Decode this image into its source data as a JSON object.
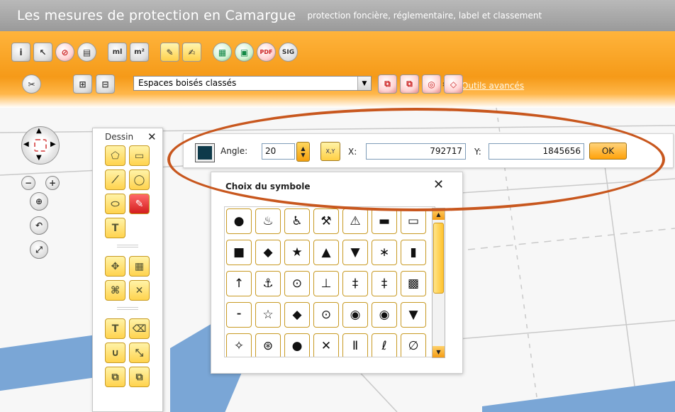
{
  "title": {
    "main": "Les mesures de protection en Camargue",
    "subtitle": "protection foncière, réglementaire, label et classement"
  },
  "toolbar": {
    "row1_icons": [
      "info-icon",
      "pointer-icon",
      "no-entry-icon",
      "export-icon",
      "measure-length-icon",
      "measure-area-icon",
      "draw-pencil-icon",
      "annotate-icon",
      "export-excel-icon",
      "export-map-icon",
      "export-pdf-icon",
      "sig-icon"
    ],
    "ml_label": "ml",
    "m2_label": "m²",
    "sig_label": "SIG",
    "info_label": "i",
    "advanced_tools_label": "Outils avancés",
    "layer_select_value": "Espaces boisés classés",
    "row2_icons": [
      "cut-icon",
      "add-layer-icon",
      "remove-layer-icon"
    ],
    "row2_right_icons": [
      "edit-red-1-icon",
      "edit-red-2-icon",
      "edit-red-3-icon",
      "edit-red-4-icon"
    ]
  },
  "navigation": {
    "zoom_minus": "−",
    "zoom_plus": "+",
    "buttons": [
      "zoom-box-icon",
      "back-icon",
      "full-extent-icon"
    ]
  },
  "dessin_panel": {
    "title": "Dessin",
    "close": "✕",
    "text_tool_label": "T"
  },
  "angle_bar": {
    "angle_label": "Angle:",
    "angle_value": "20",
    "xy_button_label": "X,Y",
    "x_label": "X:",
    "x_value": "792717",
    "y_label": "Y:",
    "y_value": "1845656",
    "ok_label": "OK",
    "color": "#0e3a4a"
  },
  "symbol_chooser": {
    "title": "Choix du symbole",
    "close": "✕",
    "rows": [
      [
        "●",
        "♨",
        "♿",
        "⚒",
        "⚠",
        "▬",
        "▭"
      ],
      [
        "■",
        "◆",
        "★",
        "▲",
        "▼",
        "∗",
        "▮"
      ],
      [
        "↑",
        "⚓",
        "⊙",
        "⊥",
        "‡",
        "‡",
        "▩"
      ],
      [
        "⁃",
        "☆",
        "◆",
        "⊙",
        "◉",
        "◉",
        "▼"
      ],
      [
        "✧",
        "⊛",
        "●",
        "✕",
        "Ⅱ",
        "ℓ",
        "∅"
      ]
    ]
  },
  "colors": {
    "orange": "#f59a18",
    "highlight_ellipse": "#c8571e",
    "water": "#7aa6d6"
  }
}
